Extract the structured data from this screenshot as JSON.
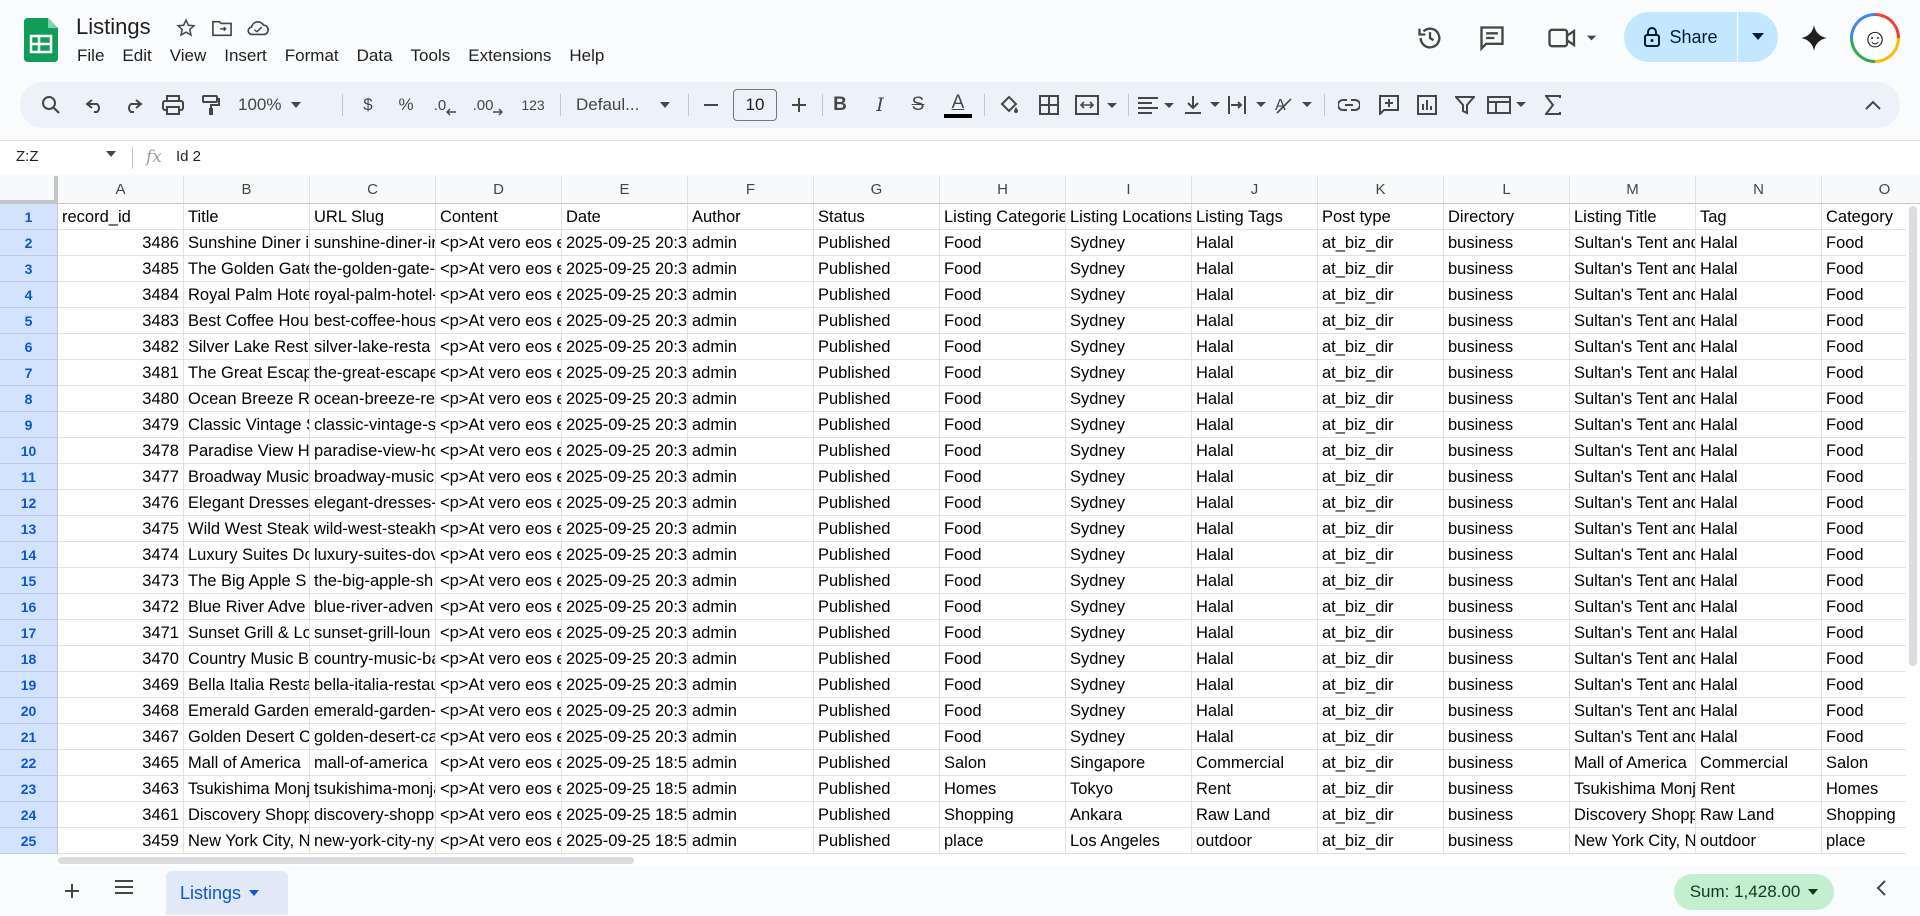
{
  "app": {
    "title": "Listings",
    "menu": [
      "File",
      "Edit",
      "View",
      "Insert",
      "Format",
      "Data",
      "Tools",
      "Extensions",
      "Help"
    ],
    "share_label": "Share"
  },
  "toolbar": {
    "zoom": "100%",
    "currency": "$",
    "percent": "%",
    "dec_decrease": ".0",
    "dec_increase": ".00",
    "number_format": "123",
    "font": "Defaul...",
    "font_size": "10",
    "bold": "B",
    "italic": "I",
    "strike": "S",
    "text_color": "A"
  },
  "formula_bar": {
    "name_box": "Z:Z",
    "fx": "fx",
    "content": "Id 2"
  },
  "columns": [
    {
      "letter": "A"
    },
    {
      "letter": "B"
    },
    {
      "letter": "C"
    },
    {
      "letter": "D"
    },
    {
      "letter": "E"
    },
    {
      "letter": "F"
    },
    {
      "letter": "G"
    },
    {
      "letter": "H"
    },
    {
      "letter": "I"
    },
    {
      "letter": "J"
    },
    {
      "letter": "K"
    },
    {
      "letter": "L"
    },
    {
      "letter": "M"
    },
    {
      "letter": "N"
    },
    {
      "letter": "O"
    }
  ],
  "rows": [
    [
      "record_id",
      "Title",
      "URL Slug",
      "Content",
      "Date",
      "Author",
      "Status",
      "Listing Categories",
      "Listing Locations",
      "Listing Tags",
      "Post type",
      "Directory",
      "Listing Title",
      "Tag",
      "Category"
    ],
    [
      "3486",
      "Sunshine Diner i",
      "sunshine-diner-in",
      "<p>At vero eos e",
      "2025-09-25 20:3",
      "admin",
      "Published",
      "Food",
      "Sydney",
      "Halal",
      "at_biz_dir",
      "business",
      "Sultan's Tent and",
      "Halal",
      "Food"
    ],
    [
      "3485",
      "The Golden Gate",
      "the-golden-gate-",
      "<p>At vero eos e",
      "2025-09-25 20:3",
      "admin",
      "Published",
      "Food",
      "Sydney",
      "Halal",
      "at_biz_dir",
      "business",
      "Sultan's Tent and",
      "Halal",
      "Food"
    ],
    [
      "3484",
      "Royal Palm Hote",
      "royal-palm-hotel-",
      "<p>At vero eos e",
      "2025-09-25 20:3",
      "admin",
      "Published",
      "Food",
      "Sydney",
      "Halal",
      "at_biz_dir",
      "business",
      "Sultan's Tent and",
      "Halal",
      "Food"
    ],
    [
      "3483",
      "Best Coffee Hou",
      "best-coffee-hous",
      "<p>At vero eos e",
      "2025-09-25 20:3",
      "admin",
      "Published",
      "Food",
      "Sydney",
      "Halal",
      "at_biz_dir",
      "business",
      "Sultan's Tent and",
      "Halal",
      "Food"
    ],
    [
      "3482",
      "Silver Lake Rest",
      "silver-lake-resta",
      "<p>At vero eos e",
      "2025-09-25 20:3",
      "admin",
      "Published",
      "Food",
      "Sydney",
      "Halal",
      "at_biz_dir",
      "business",
      "Sultan's Tent and",
      "Halal",
      "Food"
    ],
    [
      "3481",
      "The Great Escap",
      "the-great-escape",
      "<p>At vero eos e",
      "2025-09-25 20:3",
      "admin",
      "Published",
      "Food",
      "Sydney",
      "Halal",
      "at_biz_dir",
      "business",
      "Sultan's Tent and",
      "Halal",
      "Food"
    ],
    [
      "3480",
      "Ocean Breeze R",
      "ocean-breeze-re",
      "<p>At vero eos e",
      "2025-09-25 20:3",
      "admin",
      "Published",
      "Food",
      "Sydney",
      "Halal",
      "at_biz_dir",
      "business",
      "Sultan's Tent and",
      "Halal",
      "Food"
    ],
    [
      "3479",
      "Classic Vintage S",
      "classic-vintage-s",
      "<p>At vero eos e",
      "2025-09-25 20:3",
      "admin",
      "Published",
      "Food",
      "Sydney",
      "Halal",
      "at_biz_dir",
      "business",
      "Sultan's Tent and",
      "Halal",
      "Food"
    ],
    [
      "3478",
      "Paradise View H",
      "paradise-view-ho",
      "<p>At vero eos e",
      "2025-09-25 20:3",
      "admin",
      "Published",
      "Food",
      "Sydney",
      "Halal",
      "at_biz_dir",
      "business",
      "Sultan's Tent and",
      "Halal",
      "Food"
    ],
    [
      "3477",
      "Broadway Music",
      "broadway-music",
      "<p>At vero eos e",
      "2025-09-25 20:3",
      "admin",
      "Published",
      "Food",
      "Sydney",
      "Halal",
      "at_biz_dir",
      "business",
      "Sultan's Tent and",
      "Halal",
      "Food"
    ],
    [
      "3476",
      "Elegant Dresses",
      "elegant-dresses-",
      "<p>At vero eos e",
      "2025-09-25 20:3",
      "admin",
      "Published",
      "Food",
      "Sydney",
      "Halal",
      "at_biz_dir",
      "business",
      "Sultan's Tent and",
      "Halal",
      "Food"
    ],
    [
      "3475",
      "Wild West Steak",
      "wild-west-steakh",
      "<p>At vero eos e",
      "2025-09-25 20:3",
      "admin",
      "Published",
      "Food",
      "Sydney",
      "Halal",
      "at_biz_dir",
      "business",
      "Sultan's Tent and",
      "Halal",
      "Food"
    ],
    [
      "3474",
      "Luxury Suites Do",
      "luxury-suites-dov",
      "<p>At vero eos e",
      "2025-09-25 20:3",
      "admin",
      "Published",
      "Food",
      "Sydney",
      "Halal",
      "at_biz_dir",
      "business",
      "Sultan's Tent and",
      "Halal",
      "Food"
    ],
    [
      "3473",
      "The Big Apple S",
      "the-big-apple-sh",
      "<p>At vero eos e",
      "2025-09-25 20:3",
      "admin",
      "Published",
      "Food",
      "Sydney",
      "Halal",
      "at_biz_dir",
      "business",
      "Sultan's Tent and",
      "Halal",
      "Food"
    ],
    [
      "3472",
      "Blue River Adve",
      "blue-river-adven",
      "<p>At vero eos e",
      "2025-09-25 20:3",
      "admin",
      "Published",
      "Food",
      "Sydney",
      "Halal",
      "at_biz_dir",
      "business",
      "Sultan's Tent and",
      "Halal",
      "Food"
    ],
    [
      "3471",
      "Sunset Grill & Lo",
      "sunset-grill-loun",
      "<p>At vero eos e",
      "2025-09-25 20:3",
      "admin",
      "Published",
      "Food",
      "Sydney",
      "Halal",
      "at_biz_dir",
      "business",
      "Sultan's Tent and",
      "Halal",
      "Food"
    ],
    [
      "3470",
      "Country Music B",
      "country-music-ba",
      "<p>At vero eos e",
      "2025-09-25 20:3",
      "admin",
      "Published",
      "Food",
      "Sydney",
      "Halal",
      "at_biz_dir",
      "business",
      "Sultan's Tent and",
      "Halal",
      "Food"
    ],
    [
      "3469",
      "Bella Italia Resta",
      "bella-italia-restau",
      "<p>At vero eos e",
      "2025-09-25 20:3",
      "admin",
      "Published",
      "Food",
      "Sydney",
      "Halal",
      "at_biz_dir",
      "business",
      "Sultan's Tent and",
      "Halal",
      "Food"
    ],
    [
      "3468",
      "Emerald Garden",
      "emerald-garden-",
      "<p>At vero eos e",
      "2025-09-25 20:3",
      "admin",
      "Published",
      "Food",
      "Sydney",
      "Halal",
      "at_biz_dir",
      "business",
      "Sultan's Tent and",
      "Halal",
      "Food"
    ],
    [
      "3467",
      "Golden Desert C",
      "golden-desert-ca",
      "<p>At vero eos e",
      "2025-09-25 20:3",
      "admin",
      "Published",
      "Food",
      "Sydney",
      "Halal",
      "at_biz_dir",
      "business",
      "Sultan's Tent and",
      "Halal",
      "Food"
    ],
    [
      "3465",
      "Mall of America",
      "mall-of-america",
      "<p>At vero eos e",
      "2025-09-25 18:5",
      "admin",
      "Published",
      "Salon",
      "Singapore",
      "Commercial",
      "at_biz_dir",
      "business",
      "Mall of America",
      "Commercial",
      "Salon"
    ],
    [
      "3463",
      "Tsukishima Monj",
      "tsukishima-monja",
      "<p>At vero eos e",
      "2025-09-25 18:5",
      "admin",
      "Published",
      "Homes",
      "Tokyo",
      "Rent",
      "at_biz_dir",
      "business",
      "Tsukishima Monj",
      "Rent",
      "Homes"
    ],
    [
      "3461",
      "Discovery Shopp",
      "discovery-shopp",
      "<p>At vero eos e",
      "2025-09-25 18:5",
      "admin",
      "Published",
      "Shopping",
      "Ankara",
      "Raw Land",
      "at_biz_dir",
      "business",
      "Discovery Shopp",
      "Raw Land",
      "Shopping"
    ],
    [
      "3459",
      "New York City, N",
      "new-york-city-ny",
      "<p>At vero eos e",
      "2025-09-25 18:5",
      "admin",
      "Published",
      "place",
      "Los Angeles",
      "outdoor",
      "at_biz_dir",
      "business",
      "New York City, N",
      "outdoor",
      "place"
    ]
  ],
  "bottom": {
    "sheet_tab": "Listings",
    "sum": "Sum: 1,428.00"
  },
  "colors": {
    "accent": "#0b57d0",
    "share_bg": "#c2e7ff",
    "sum_bg": "#c4eed0"
  }
}
